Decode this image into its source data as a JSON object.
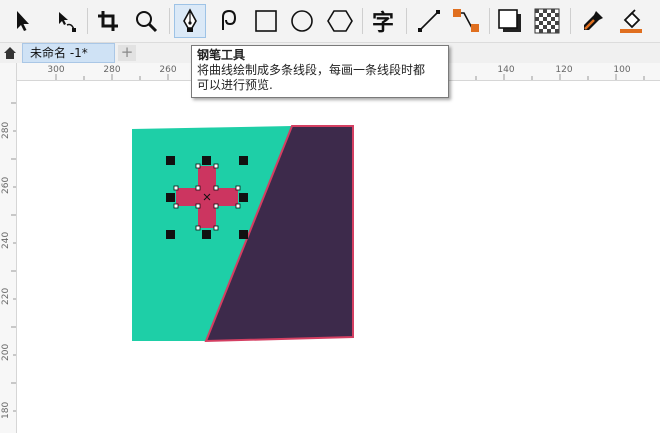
{
  "toolbar": {
    "tools": [
      {
        "name": "pick-tool",
        "icon": "arrow-pointer-icon",
        "active": false
      },
      {
        "name": "shape-tool",
        "icon": "node-edit-icon",
        "active": false
      },
      {
        "name": "crop-tool",
        "icon": "crop-icon",
        "active": false
      },
      {
        "name": "zoom-tool",
        "icon": "magnifier-icon",
        "active": false
      },
      {
        "name": "pen-tool",
        "icon": "pen-nib-icon",
        "active": true
      },
      {
        "name": "curve-tool",
        "icon": "spiral-curve-icon",
        "active": false
      },
      {
        "name": "rectangle-tool",
        "icon": "rectangle-icon",
        "active": false
      },
      {
        "name": "ellipse-tool",
        "icon": "ellipse-icon",
        "active": false
      },
      {
        "name": "polygon-tool",
        "icon": "hexagon-icon",
        "active": false
      },
      {
        "name": "text-tool",
        "icon": "text-icon",
        "active": false
      },
      {
        "name": "line-tool",
        "icon": "line-icon",
        "active": false
      },
      {
        "name": "connector-tool",
        "icon": "connector-icon",
        "active": false
      },
      {
        "name": "shadow-tool",
        "icon": "drop-shadow-icon",
        "active": false
      },
      {
        "name": "transparency-tool",
        "icon": "checkerboard-icon",
        "active": false
      },
      {
        "name": "eyedropper-tool",
        "icon": "eyedropper-icon",
        "active": false
      },
      {
        "name": "fill-tool",
        "icon": "paint-bucket-icon",
        "active": false
      }
    ],
    "text_tool_glyph": "字"
  },
  "document_tab": {
    "title": "未命名 -1*",
    "add_label": "+"
  },
  "ruler": {
    "horizontal_labels": [
      "300",
      "280",
      "260",
      "140",
      "120",
      "100"
    ],
    "vertical_labels": [
      "280",
      "260",
      "240",
      "220",
      "200",
      "180"
    ]
  },
  "tooltip": {
    "title": "钢笔工具",
    "line1": "将曲线绘制成多条线段，每画一条线段时都",
    "line2": "可以进行预览."
  },
  "colors": {
    "teal": "#1ecfa7",
    "purple": "#3d2a4b",
    "outline": "#d43f62",
    "cross": "#cc3560",
    "active_tool": "#dbe9f7"
  }
}
